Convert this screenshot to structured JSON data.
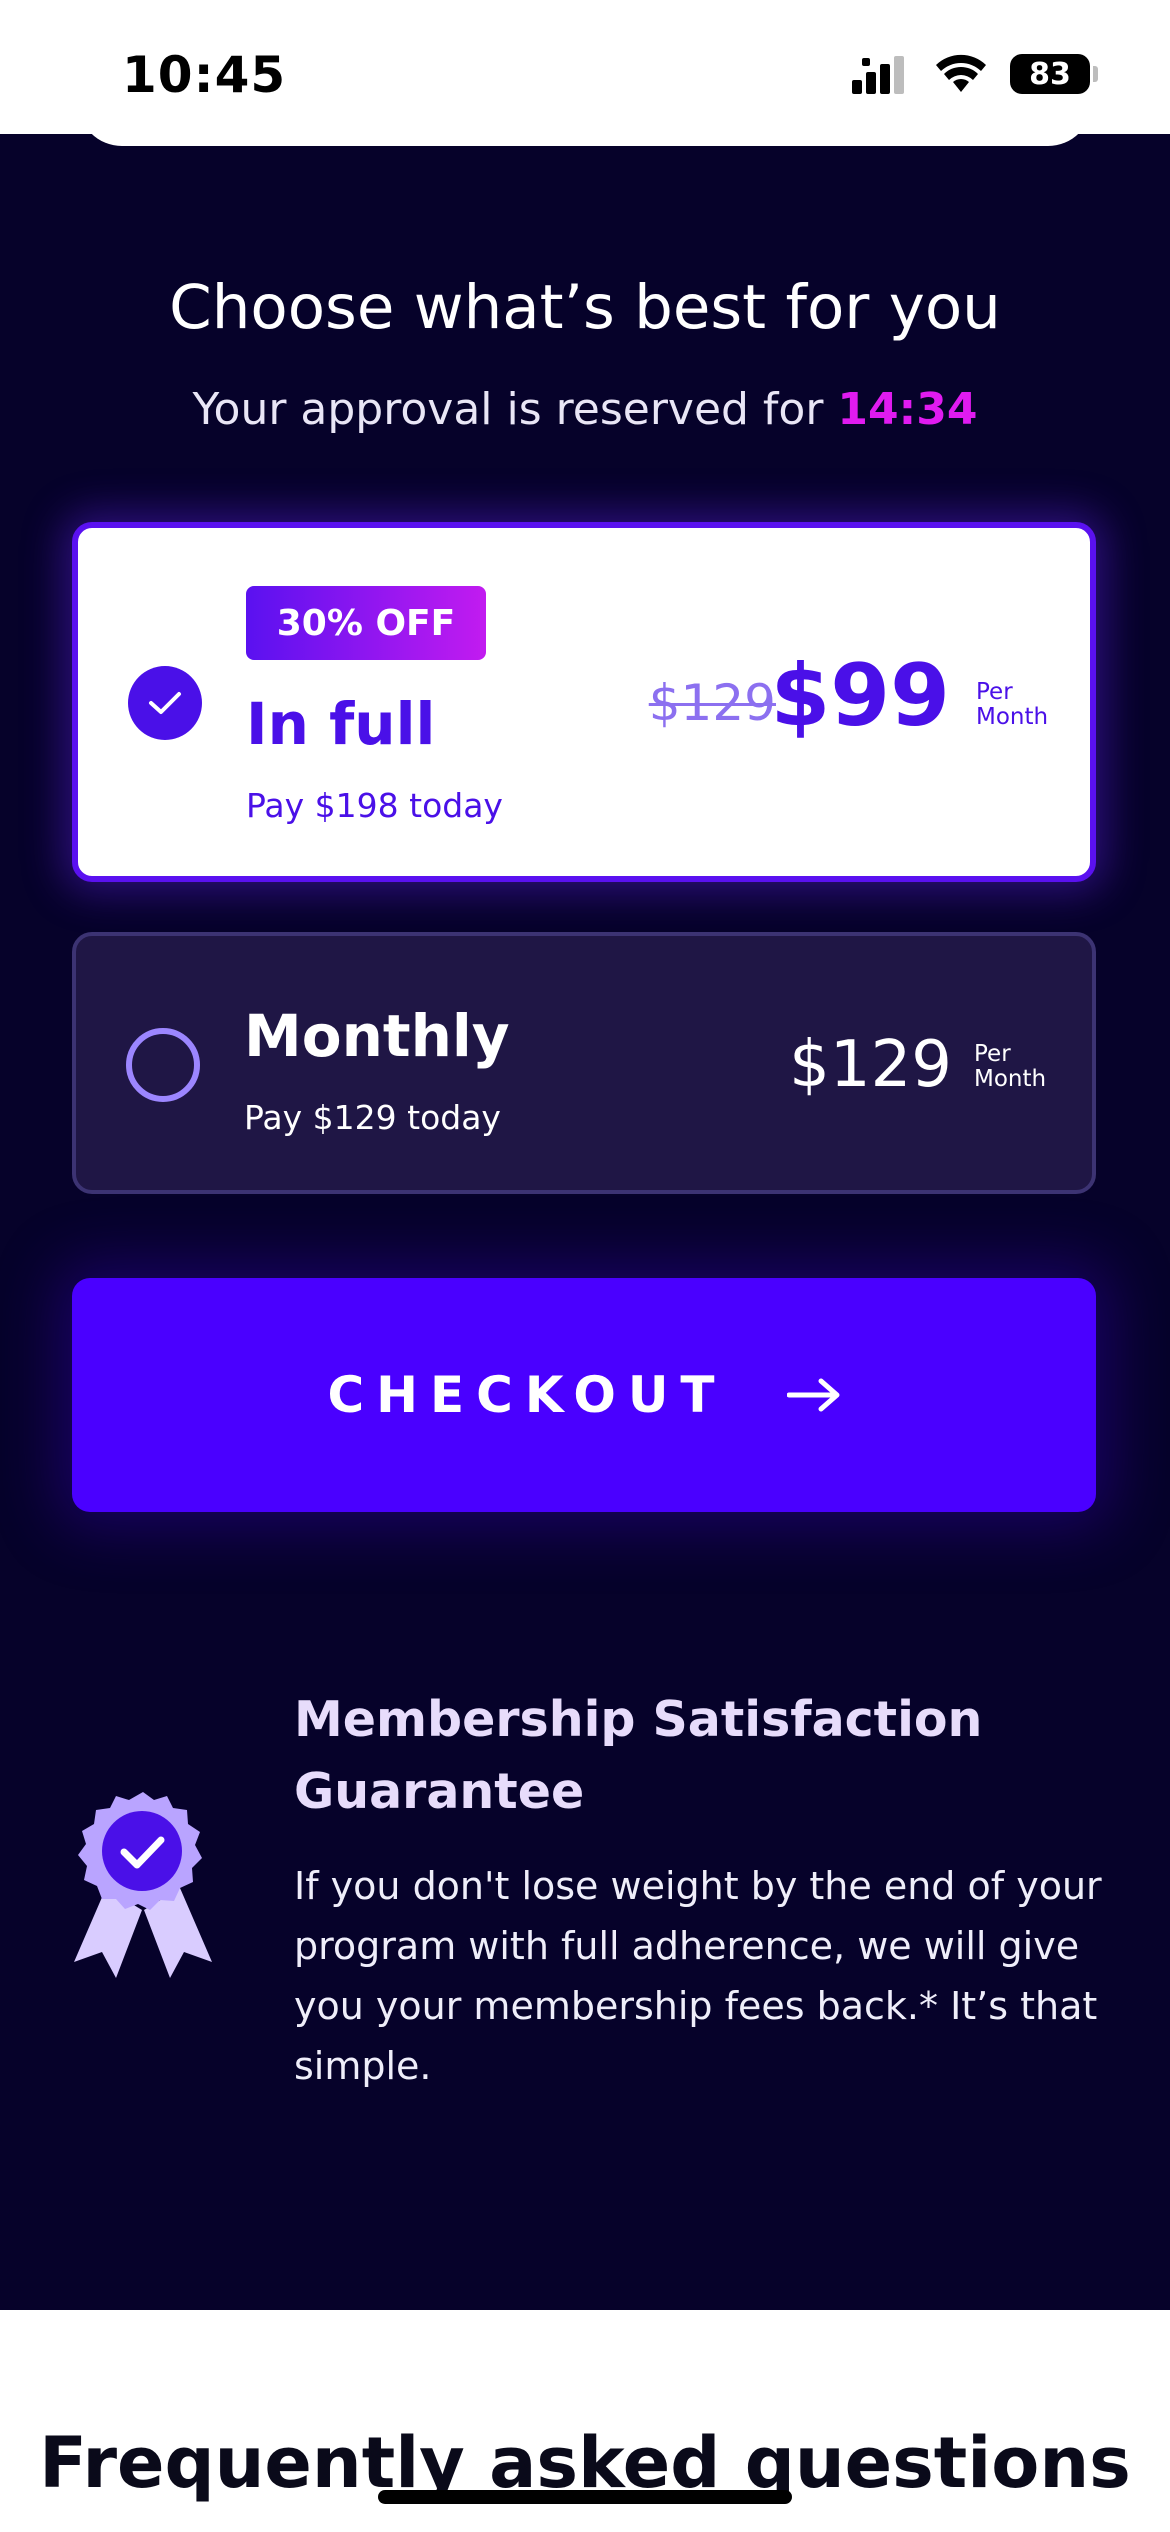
{
  "status_bar": {
    "time": "10:45",
    "battery": "83"
  },
  "header": {
    "title": "Choose what’s best for you",
    "subtitle_prefix": "Your approval is reserved for ",
    "timer": "14:34"
  },
  "plans": [
    {
      "badge": "30% OFF",
      "title": "In full",
      "subtitle": "Pay $198 today",
      "old_price": "$129",
      "price": "$99",
      "per_line1": "Per",
      "per_line2": "Month",
      "selected": true
    },
    {
      "title": "Monthly",
      "subtitle": "Pay $129 today",
      "price": "$129",
      "per_line1": "Per",
      "per_line2": "Month",
      "selected": false
    }
  ],
  "checkout": {
    "label": "CHECKOUT",
    "icon": "arrow-right-icon"
  },
  "guarantee": {
    "icon": "ribbon-badge-icon",
    "title": "Membership Satisfaction Guarantee",
    "text": "If you don't lose weight by the end of your program with full adherence, we will give you your membership fees back.* It’s that simple."
  },
  "faq": {
    "title": "Frequently asked questions"
  },
  "colors": {
    "background": "#06022a",
    "accent": "#4a00ff",
    "timer": "#e01bf0",
    "card_border": "#5a11f0"
  }
}
